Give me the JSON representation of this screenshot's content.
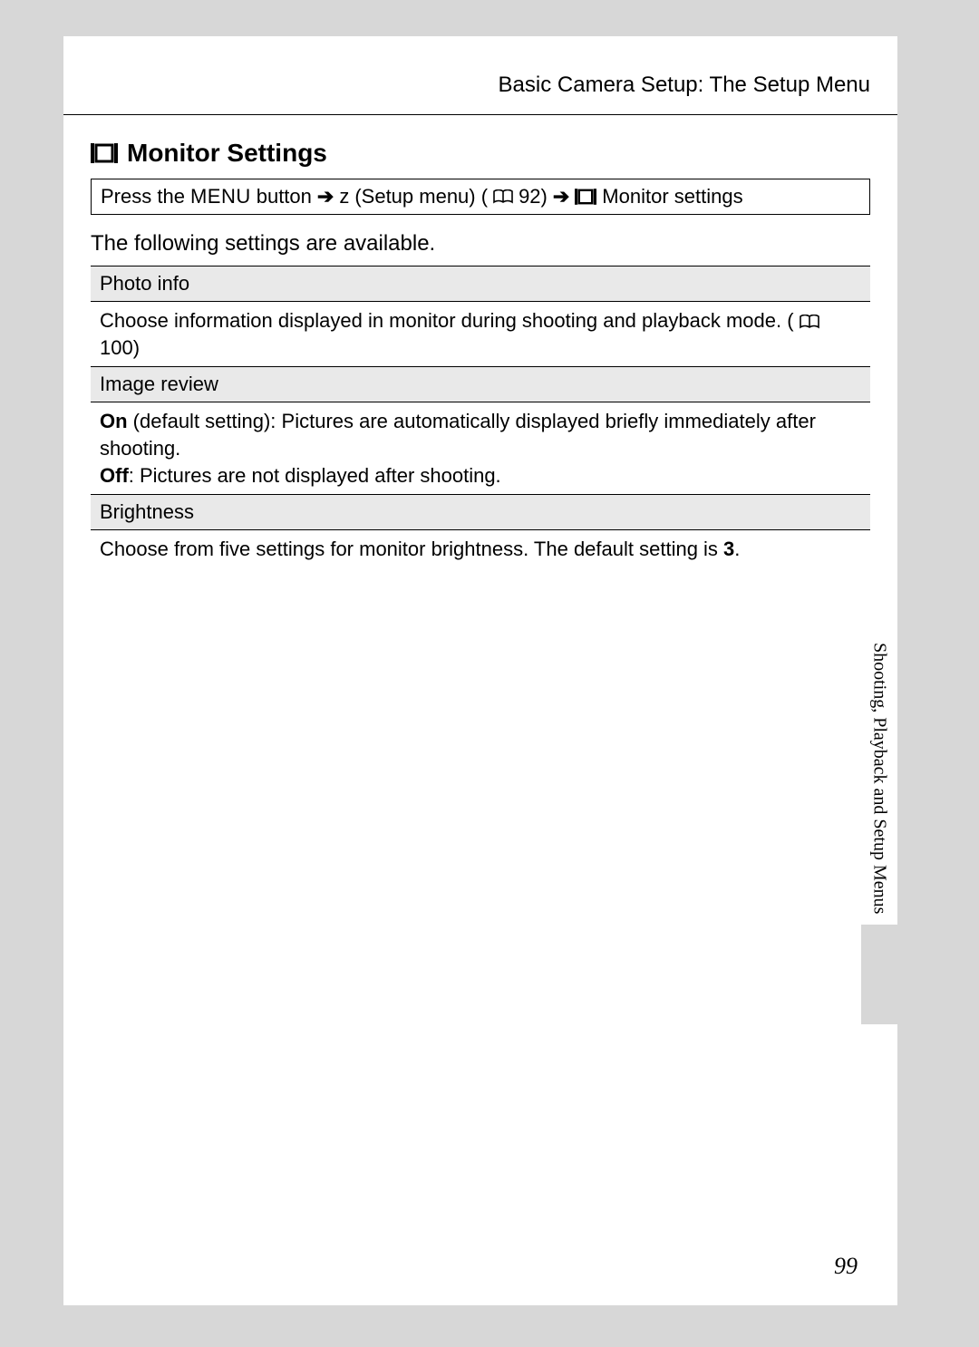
{
  "header": {
    "breadcrumb": "Basic Camera Setup: The Setup Menu"
  },
  "section": {
    "title": "Monitor Settings"
  },
  "nav": {
    "prefix": "Press the ",
    "menu_label": "MENU",
    "after_menu": " button",
    "arrow1": "➔",
    "setup_symbol": "z",
    "setup_text": "  (Setup menu) (",
    "pageref1": " 92)",
    "arrow2": "➔",
    "monitor_text": " Monitor settings"
  },
  "intro": "The following settings are available.",
  "rows": {
    "photo_info": {
      "head": "Photo info",
      "body_a": "Choose information displayed in monitor during shooting and playback mode. (",
      "pageref": " 100)"
    },
    "image_review": {
      "head": "Image review",
      "on_label": "On",
      "on_text": " (default setting): Pictures are automatically displayed briefly immediately after shooting.",
      "off_label": "Off",
      "off_text": ": Pictures are not displayed after shooting."
    },
    "brightness": {
      "head": "Brightness",
      "body_a": "Choose from five settings for monitor brightness. The default setting is ",
      "value": "3",
      "body_b": "."
    }
  },
  "side_tab": "Shooting, Playback and Setup Menus",
  "page_number": "99"
}
